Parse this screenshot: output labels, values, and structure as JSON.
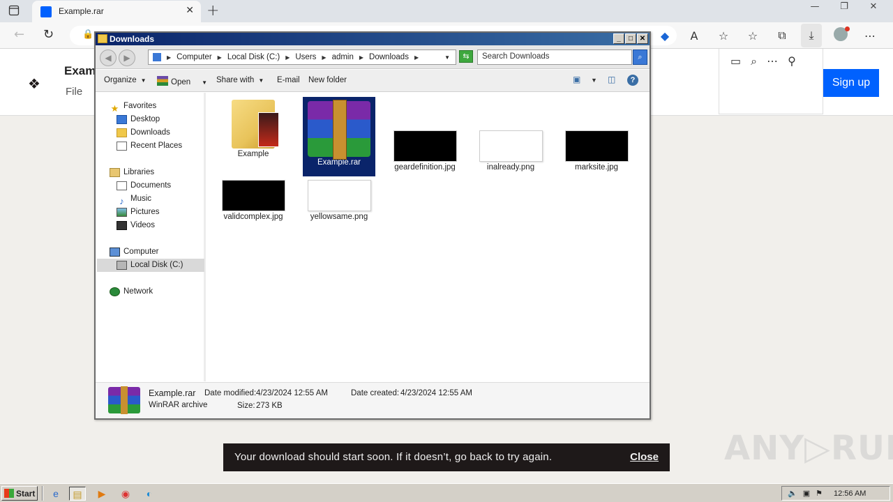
{
  "browser": {
    "tab_title": "Example.rar",
    "tab_close": "✕",
    "new_tab": "+",
    "window_controls": [
      "—",
      "❐",
      "✕"
    ]
  },
  "page": {
    "file_title": "Exam",
    "file_menu": "File",
    "signup_label": "Sign up",
    "toast_message": "Your download should start soon. If it doesn’t, go back to try again.",
    "toast_close": "Close",
    "watermark": "ANY▷RUN"
  },
  "explorer": {
    "title": "Downloads",
    "breadcrumb": [
      "Computer",
      "Local Disk (C:)",
      "Users",
      "admin",
      "Downloads"
    ],
    "search_placeholder": "Search Downloads",
    "commands": {
      "organize": "Organize",
      "open": "Open",
      "share_with": "Share with",
      "email": "E-mail",
      "new_folder": "New folder"
    },
    "sidebar": {
      "favorites": "Favorites",
      "desktop": "Desktop",
      "downloads": "Downloads",
      "recent_places": "Recent Places",
      "libraries": "Libraries",
      "documents": "Documents",
      "music": "Music",
      "pictures": "Pictures",
      "videos": "Videos",
      "computer": "Computer",
      "local_disk": "Local Disk (C:)",
      "network": "Network"
    },
    "files": [
      {
        "name": "Example",
        "type": "folder"
      },
      {
        "name": "Example.rar",
        "type": "rar",
        "selected": true
      },
      {
        "name": "geardefinition.jpg",
        "type": "image-black"
      },
      {
        "name": "inalready.png",
        "type": "image-white"
      },
      {
        "name": "marksite.jpg",
        "type": "image-black"
      },
      {
        "name": "validcomplex.jpg",
        "type": "image-black"
      },
      {
        "name": "yellowsame.png",
        "type": "image-white"
      }
    ],
    "details": {
      "name": "Example.rar",
      "type": "WinRAR archive",
      "modified_label": "Date modified:",
      "modified_value": "4/23/2024 12:55 AM",
      "created_label": "Date created:",
      "created_value": "4/23/2024 12:55 AM",
      "size_label": "Size:",
      "size_value": "273 KB"
    }
  },
  "taskbar": {
    "start_label": "Start",
    "clock": "12:56 AM"
  },
  "colors": {
    "accent": "#0061fe",
    "title_bar": "#0a246a",
    "toast_bg": "#1e1919"
  }
}
